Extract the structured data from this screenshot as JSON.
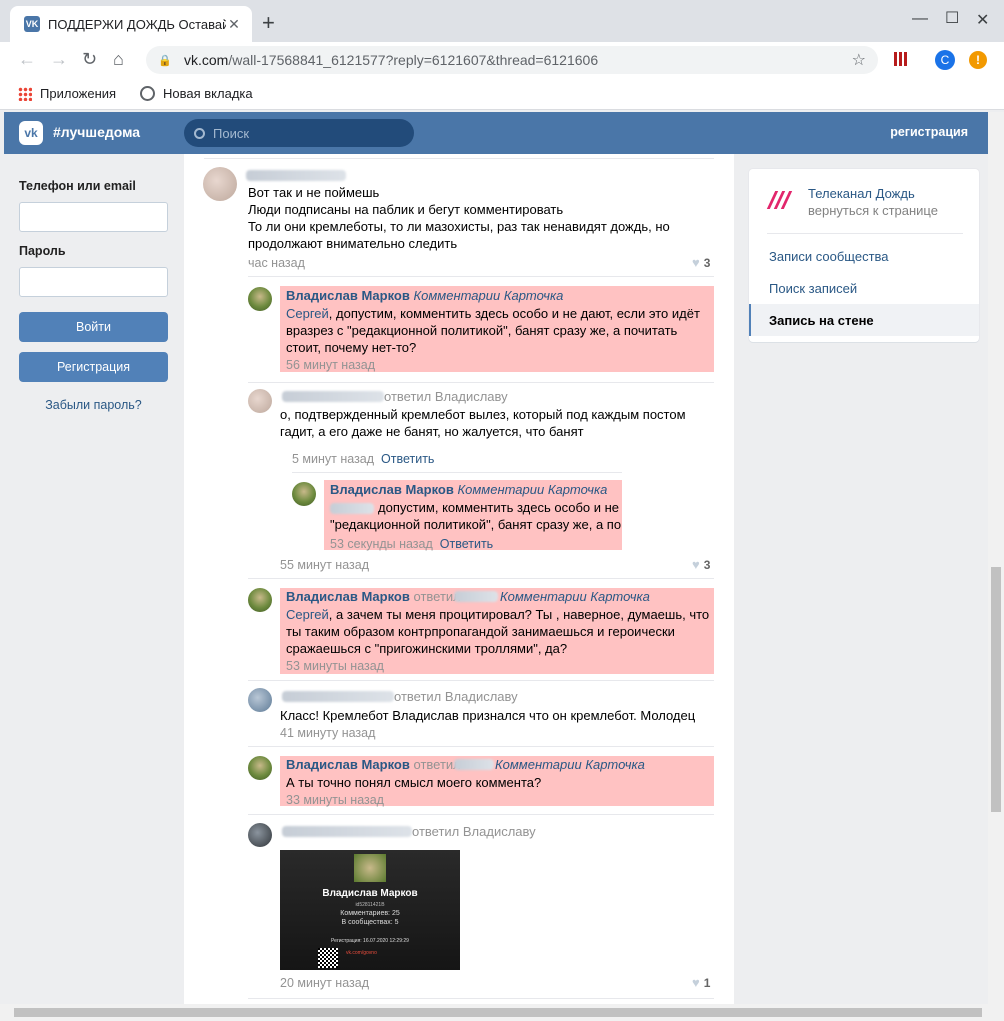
{
  "browser": {
    "tab_title": "ПОДДЕРЖИ ДОЖДЬ Оставайтесь",
    "tab_favicon": "vk-icon",
    "url_host": "vk.com",
    "url_path": "/wall-17568841_6121577?reply=6121607&thread=6121606",
    "profile_initial": "C",
    "warning_glyph": "!",
    "bookmarks": [
      "Приложения",
      "Новая вкладка"
    ]
  },
  "vk_header": {
    "logo": "vk",
    "title": "#лучшедома",
    "search_placeholder": "Поиск",
    "register": "регистрация"
  },
  "login": {
    "phone_label": "Телефон или email",
    "password_label": "Пароль",
    "login_button": "Войти",
    "register_button": "Регистрация",
    "forgot": "Забыли пароль?"
  },
  "feed": {
    "post1": {
      "lines": [
        "Вот так и не поймешь",
        "Люди подписаны на паблик и бегут комментировать",
        "То ли они кремлеботы, то ли мазохисты, раз так ненавидят дождь, но",
        "продолжают внимательно следить"
      ],
      "time": "час назад",
      "likes": "3"
    },
    "reply1": {
      "author": "Владислав Марков",
      "badge": "Комментарии Карточка",
      "mention": "Сергей",
      "line1": ", допустим, комментить здесь особо и не дают, если это идёт",
      "line2": "вразрез с \"редакционной политикой\", банят сразу же, а почитать",
      "line3": "стоит, почему нет-то?",
      "time": "56 минут назад"
    },
    "reply2": {
      "answered": "ответил Владиславу",
      "line1": "о, подтвержденный кремлебот вылез, который под каждым постом",
      "line2": "гадит, а его даже не банят, но жалуется, что банят",
      "time": "5 минут назад",
      "reply_link": "Ответить",
      "nested": {
        "author": "Владислав Марков",
        "badge": "Комментарии Карточка",
        "line1": "допустим, комментить здесь особо и не",
        "line2": "\"редакционной политикой\", банят сразу же, а по",
        "time": "53 секунды назад",
        "reply_link": "Ответить"
      },
      "time_outer": "55 минут назад",
      "likes": "3"
    },
    "reply3": {
      "author": "Владислав Марков",
      "answered": "ответил",
      "badge": "Комментарии Карточка",
      "mention": "Сергей",
      "line1": ", а зачем ты меня процитировал? Ты , наверное, думаешь, что",
      "line2": "ты таким образом контрпропагандой занимаешься и героически",
      "line3": "сражаешься с \"пригожинскими троллями\", да?",
      "time": "53 минуты назад"
    },
    "reply4": {
      "answered": "ответил Владиславу",
      "line1": "Класс! Кремлебот Владислав признался что он кремлебот. Молодец",
      "time": "41 минуту назад"
    },
    "reply5": {
      "author": "Владислав Марков",
      "answered": "ответил",
      "badge": "Комментарии Карточка",
      "line1": "А ты точно понял смысл моего коммента?",
      "time": "33 минуты назад"
    },
    "reply6": {
      "answered": "ответил Владиславу",
      "card": {
        "name": "Владислав Марков",
        "id": "id52811421В",
        "comments": "Комментариев: 25",
        "communities": "В сообществах: 5",
        "registered": "Регистрация: 16.07.2020 12:29:29",
        "link": "vk.com/govno"
      },
      "time": "20 минут назад",
      "likes": "1"
    }
  },
  "right_menu": {
    "channel": "Телеканал Дождь",
    "back": "вернуться к странице",
    "items": [
      "Записи сообщества",
      "Поиск записей",
      "Запись на стене"
    ]
  },
  "colors": {
    "vk_blue": "#4a76a8",
    "highlight": "#ffc2c2",
    "link": "#2a5885",
    "dozhd_pink": "#e2266c"
  }
}
